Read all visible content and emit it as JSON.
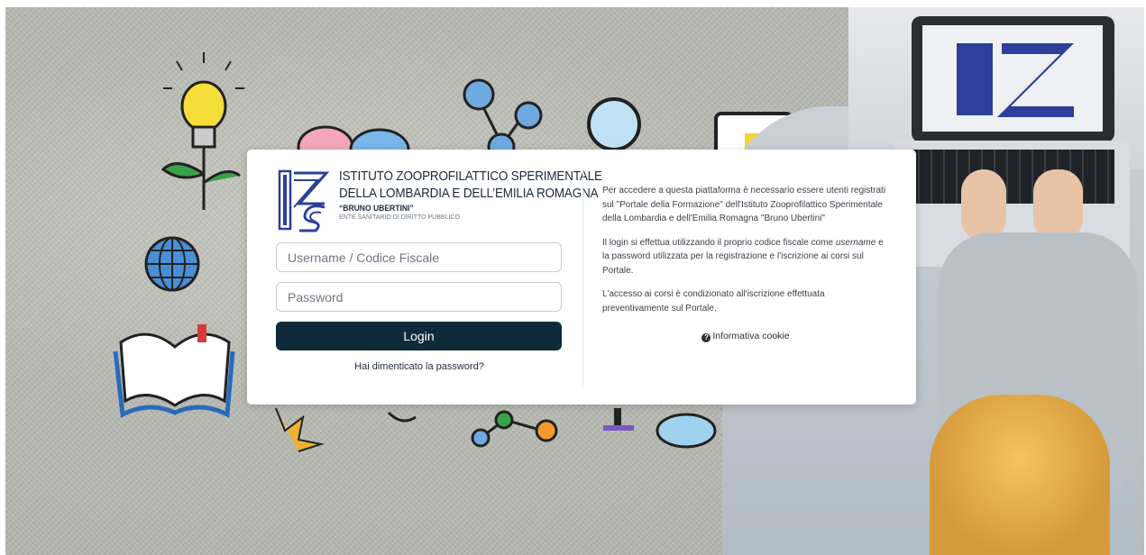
{
  "institute": {
    "name_line1": "ISTITUTO ZOOPROFILATTICO SPERIMENTALE",
    "name_line2": "DELLA LOMBARDIA E DELL’EMILIA ROMAGNA",
    "name_line3": "“BRUNO UBERTINI”",
    "tagline": "ENTE SANITARIO DI DIRITTO PUBBLICO"
  },
  "login_form": {
    "username_placeholder": "Username / Codice Fiscale",
    "password_placeholder": "Password",
    "login_label": "Login",
    "forgot_label": "Hai dimenticato la password?"
  },
  "info": {
    "p1_a": "Per accedere a questa piattaforma è necessario essere utenti registrati sul \"Portale della Formazione\" dell'Istituto Zooprofilattico Sperimentale della Lombardia e dell'Emilia Romagna \"Bruno Ubertini\"",
    "p2_a": "Il login si effettua utilizzando il proprio codice fiscale come ",
    "p2_em": "username",
    "p2_b": " e la password utilizzata per la registrazione e l'iscrizione ai corsi sul Portale.",
    "p3": "L'accesso ai corsi è condizionato all'iscrizione effettuata preventivamente sul Portale.",
    "cookie_icon": "?",
    "cookie_label": "Informativa cookie"
  },
  "colors": {
    "button_bg": "#0e2a3b",
    "logo_blue": "#2d3f9a"
  }
}
